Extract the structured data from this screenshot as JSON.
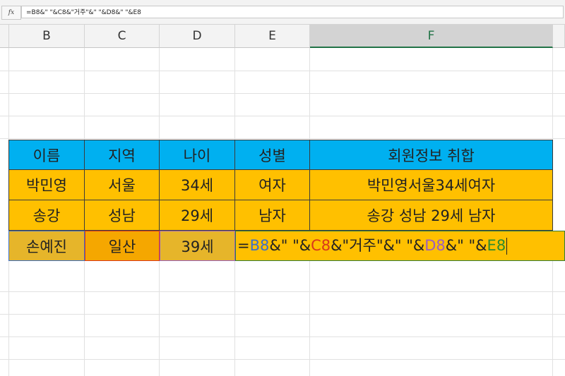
{
  "formula_bar": {
    "fx_label": "fx",
    "formula": "=B8&\" \"&C8&\"거주\"&\" \"&D8&\" \"&E8"
  },
  "columns": [
    "B",
    "C",
    "D",
    "E",
    "F"
  ],
  "table": {
    "headers": [
      "이름",
      "지역",
      "나이",
      "성별",
      "회원정보 취합"
    ],
    "rows": [
      [
        "박민영",
        "서울",
        "34세",
        "여자",
        "박민영서울34세여자"
      ],
      [
        "송강",
        "성남",
        "29세",
        "남자",
        "송강 성남 29세 남자"
      ],
      [
        "손예진",
        "일산",
        "39세",
        "",
        ""
      ]
    ]
  },
  "editing": {
    "eq": "=",
    "ref_b": "B8",
    "s1": "&\" \"&",
    "ref_c": "C8",
    "s2": "&\"거주\"&\" \"&",
    "ref_d": "D8",
    "s3": "&\" \"&",
    "ref_e": "E8"
  },
  "colors": {
    "header_fill": "#00b0f0",
    "row_fill": "#ffc000",
    "ref_b": "#3b6fc9",
    "ref_c": "#d9371c",
    "ref_d": "#9a5ec2",
    "ref_e": "#2e8b2e"
  }
}
